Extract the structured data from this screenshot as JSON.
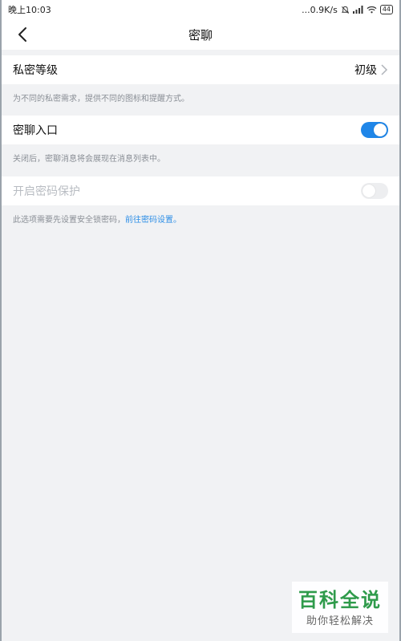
{
  "status_bar": {
    "time": "晚上10:03",
    "network_speed": "...0.9K/s",
    "battery": "44"
  },
  "header": {
    "title": "密聊"
  },
  "privacy_level": {
    "label": "私密等级",
    "value": "初级",
    "hint": "为不同的私密需求，提供不同的图标和提醒方式。"
  },
  "chat_entry": {
    "label": "密聊入口",
    "enabled": true,
    "hint": "关闭后，密聊消息将会展现在消息列表中。"
  },
  "password_protect": {
    "label": "开启密码保护",
    "enabled": false,
    "hint_prefix": "此选项需要先设置安全锁密码，",
    "hint_link": "前往密码设置",
    "hint_suffix": "。"
  },
  "watermark": {
    "title": "百科全说",
    "subtitle": "助你轻松解决"
  },
  "colors": {
    "accent": "#1f86e8",
    "link": "#2d8ee6",
    "brand_green": "#2f9b4b"
  }
}
